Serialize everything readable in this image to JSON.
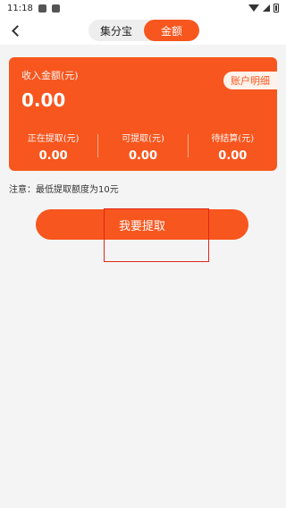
{
  "status_bar": {
    "time": "11:18"
  },
  "header": {
    "tabs": [
      {
        "label": "集分宝",
        "active": false
      },
      {
        "label": "金额",
        "active": true
      }
    ]
  },
  "balance_card": {
    "label": "收入金额(元)",
    "amount": "0.00",
    "detail_button": "账户明细",
    "stats": [
      {
        "label": "正在提取(元)",
        "value": "0.00"
      },
      {
        "label": "可提取(元)",
        "value": "0.00"
      },
      {
        "label": "待结算(元)",
        "value": "0.00"
      }
    ]
  },
  "note": "注意：最低提取额度为10元",
  "withdraw_button": "我要提取",
  "colors": {
    "accent": "#f7561e",
    "background": "#f4f4f4",
    "highlight": "#e0271a"
  }
}
